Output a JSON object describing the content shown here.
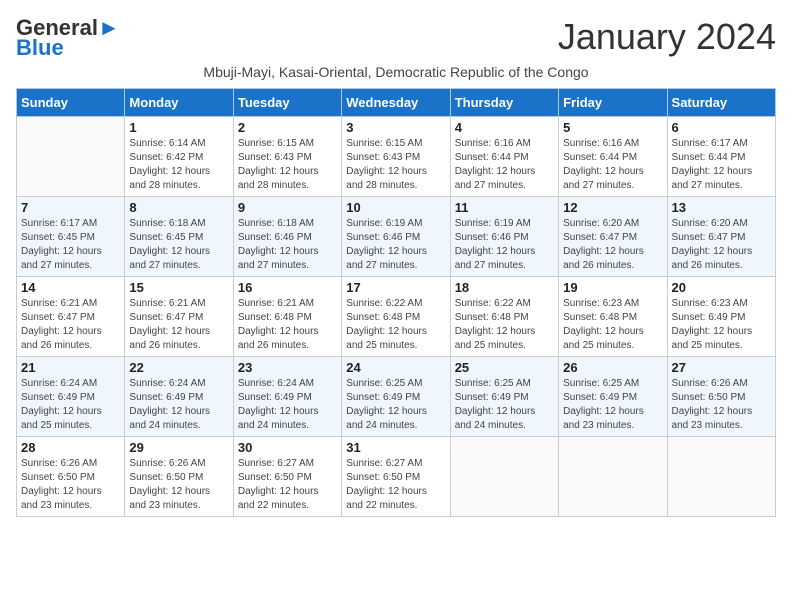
{
  "header": {
    "logo_line1": "General",
    "logo_line2": "Blue",
    "month": "January 2024",
    "subtitle": "Mbuji-Mayi, Kasai-Oriental, Democratic Republic of the Congo"
  },
  "days_of_week": [
    "Sunday",
    "Monday",
    "Tuesday",
    "Wednesday",
    "Thursday",
    "Friday",
    "Saturday"
  ],
  "weeks": [
    [
      {
        "day": "",
        "empty": true
      },
      {
        "day": "1",
        "sunrise": "6:14 AM",
        "sunset": "6:42 PM",
        "daylight": "12 hours and 28 minutes."
      },
      {
        "day": "2",
        "sunrise": "6:15 AM",
        "sunset": "6:43 PM",
        "daylight": "12 hours and 28 minutes."
      },
      {
        "day": "3",
        "sunrise": "6:15 AM",
        "sunset": "6:43 PM",
        "daylight": "12 hours and 28 minutes."
      },
      {
        "day": "4",
        "sunrise": "6:16 AM",
        "sunset": "6:44 PM",
        "daylight": "12 hours and 27 minutes."
      },
      {
        "day": "5",
        "sunrise": "6:16 AM",
        "sunset": "6:44 PM",
        "daylight": "12 hours and 27 minutes."
      },
      {
        "day": "6",
        "sunrise": "6:17 AM",
        "sunset": "6:44 PM",
        "daylight": "12 hours and 27 minutes."
      }
    ],
    [
      {
        "day": "7",
        "sunrise": "6:17 AM",
        "sunset": "6:45 PM",
        "daylight": "12 hours and 27 minutes."
      },
      {
        "day": "8",
        "sunrise": "6:18 AM",
        "sunset": "6:45 PM",
        "daylight": "12 hours and 27 minutes."
      },
      {
        "day": "9",
        "sunrise": "6:18 AM",
        "sunset": "6:46 PM",
        "daylight": "12 hours and 27 minutes."
      },
      {
        "day": "10",
        "sunrise": "6:19 AM",
        "sunset": "6:46 PM",
        "daylight": "12 hours and 27 minutes."
      },
      {
        "day": "11",
        "sunrise": "6:19 AM",
        "sunset": "6:46 PM",
        "daylight": "12 hours and 27 minutes."
      },
      {
        "day": "12",
        "sunrise": "6:20 AM",
        "sunset": "6:47 PM",
        "daylight": "12 hours and 26 minutes."
      },
      {
        "day": "13",
        "sunrise": "6:20 AM",
        "sunset": "6:47 PM",
        "daylight": "12 hours and 26 minutes."
      }
    ],
    [
      {
        "day": "14",
        "sunrise": "6:21 AM",
        "sunset": "6:47 PM",
        "daylight": "12 hours and 26 minutes."
      },
      {
        "day": "15",
        "sunrise": "6:21 AM",
        "sunset": "6:47 PM",
        "daylight": "12 hours and 26 minutes."
      },
      {
        "day": "16",
        "sunrise": "6:21 AM",
        "sunset": "6:48 PM",
        "daylight": "12 hours and 26 minutes."
      },
      {
        "day": "17",
        "sunrise": "6:22 AM",
        "sunset": "6:48 PM",
        "daylight": "12 hours and 25 minutes."
      },
      {
        "day": "18",
        "sunrise": "6:22 AM",
        "sunset": "6:48 PM",
        "daylight": "12 hours and 25 minutes."
      },
      {
        "day": "19",
        "sunrise": "6:23 AM",
        "sunset": "6:48 PM",
        "daylight": "12 hours and 25 minutes."
      },
      {
        "day": "20",
        "sunrise": "6:23 AM",
        "sunset": "6:49 PM",
        "daylight": "12 hours and 25 minutes."
      }
    ],
    [
      {
        "day": "21",
        "sunrise": "6:24 AM",
        "sunset": "6:49 PM",
        "daylight": "12 hours and 25 minutes."
      },
      {
        "day": "22",
        "sunrise": "6:24 AM",
        "sunset": "6:49 PM",
        "daylight": "12 hours and 24 minutes."
      },
      {
        "day": "23",
        "sunrise": "6:24 AM",
        "sunset": "6:49 PM",
        "daylight": "12 hours and 24 minutes."
      },
      {
        "day": "24",
        "sunrise": "6:25 AM",
        "sunset": "6:49 PM",
        "daylight": "12 hours and 24 minutes."
      },
      {
        "day": "25",
        "sunrise": "6:25 AM",
        "sunset": "6:49 PM",
        "daylight": "12 hours and 24 minutes."
      },
      {
        "day": "26",
        "sunrise": "6:25 AM",
        "sunset": "6:49 PM",
        "daylight": "12 hours and 23 minutes."
      },
      {
        "day": "27",
        "sunrise": "6:26 AM",
        "sunset": "6:50 PM",
        "daylight": "12 hours and 23 minutes."
      }
    ],
    [
      {
        "day": "28",
        "sunrise": "6:26 AM",
        "sunset": "6:50 PM",
        "daylight": "12 hours and 23 minutes."
      },
      {
        "day": "29",
        "sunrise": "6:26 AM",
        "sunset": "6:50 PM",
        "daylight": "12 hours and 23 minutes."
      },
      {
        "day": "30",
        "sunrise": "6:27 AM",
        "sunset": "6:50 PM",
        "daylight": "12 hours and 22 minutes."
      },
      {
        "day": "31",
        "sunrise": "6:27 AM",
        "sunset": "6:50 PM",
        "daylight": "12 hours and 22 minutes."
      },
      {
        "day": "",
        "empty": true
      },
      {
        "day": "",
        "empty": true
      },
      {
        "day": "",
        "empty": true
      }
    ]
  ],
  "labels": {
    "sunrise": "Sunrise:",
    "sunset": "Sunset:",
    "daylight": "Daylight:"
  }
}
